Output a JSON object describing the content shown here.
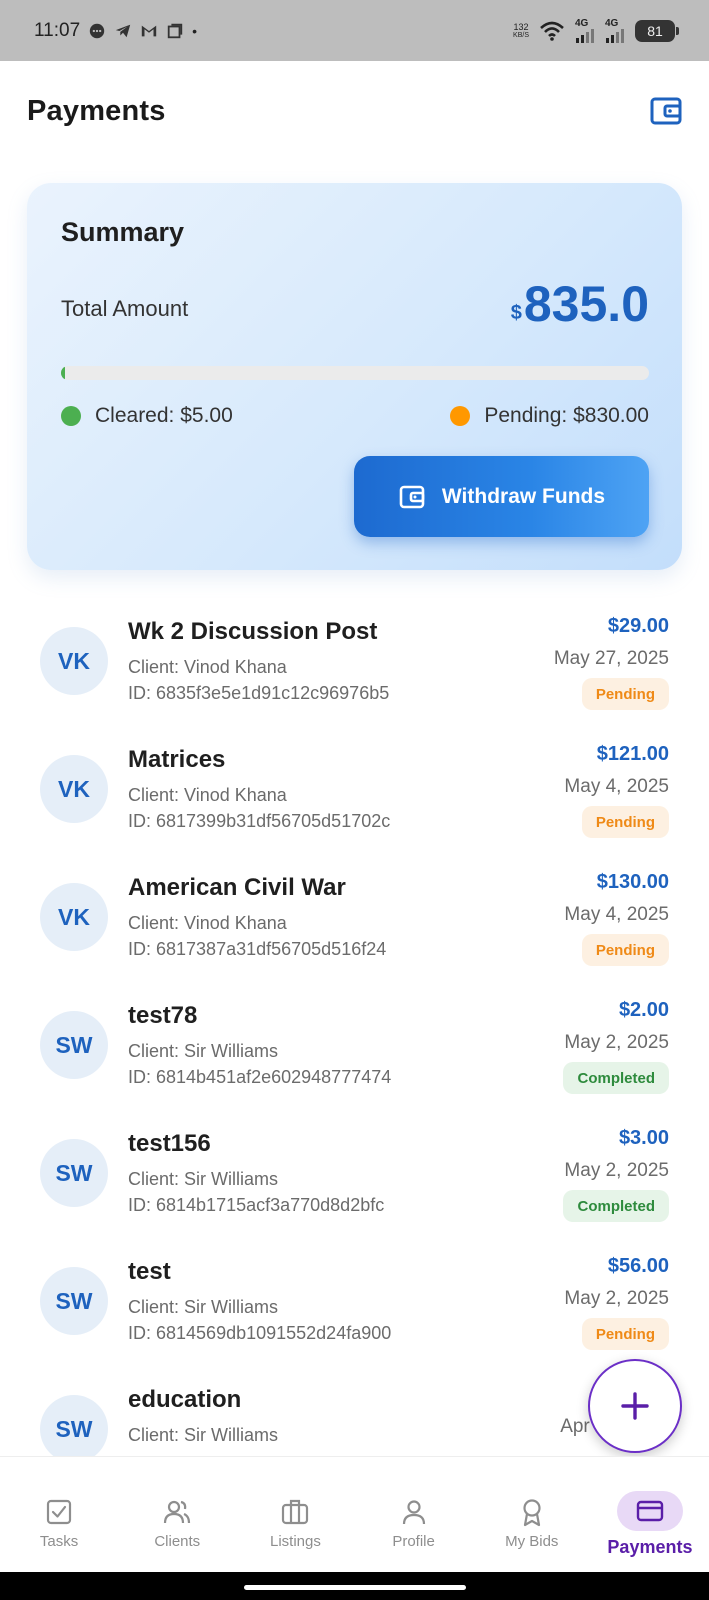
{
  "status_bar": {
    "time": "11:07",
    "network_speed_value": "132",
    "network_speed_unit": "KB/S",
    "signal_1": "4G",
    "signal_2": "4G",
    "battery": "81"
  },
  "header": {
    "title": "Payments"
  },
  "summary": {
    "title": "Summary",
    "total_label": "Total Amount",
    "currency_symbol": "$",
    "total_value": "835.0",
    "cleared_fraction": 0.006,
    "cleared_label": "Cleared: $5.00",
    "pending_label": "Pending: $830.00",
    "withdraw_label": "Withdraw Funds",
    "colors": {
      "cleared": "#4caf50",
      "pending": "#ff9800",
      "accent": "#1e62be"
    }
  },
  "payments": [
    {
      "initials": "VK",
      "title": "Wk 2 Discussion Post",
      "client": "Client: Vinod  Khana",
      "id": "ID: 6835f3e5e1d91c12c96976b5",
      "amount": "$29.00",
      "date": "May 27, 2025",
      "status": "Pending",
      "status_type": "pending"
    },
    {
      "initials": "VK",
      "title": "Matrices",
      "client": "Client: Vinod  Khana",
      "id": "ID: 6817399b31df56705d51702c",
      "amount": "$121.00",
      "date": "May 4, 2025",
      "status": "Pending",
      "status_type": "pending"
    },
    {
      "initials": "VK",
      "title": "American Civil War",
      "client": "Client: Vinod  Khana",
      "id": "ID: 6817387a31df56705d516f24",
      "amount": "$130.00",
      "date": "May 4, 2025",
      "status": "Pending",
      "status_type": "pending"
    },
    {
      "initials": "SW",
      "title": "test78",
      "client": "Client: Sir Williams",
      "id": "ID: 6814b451af2e602948777474",
      "amount": "$2.00",
      "date": "May 2, 2025",
      "status": "Completed",
      "status_type": "completed"
    },
    {
      "initials": "SW",
      "title": "test156",
      "client": "Client: Sir Williams",
      "id": "ID: 6814b1715acf3a770d8d2bfc",
      "amount": "$3.00",
      "date": "May 2, 2025",
      "status": "Completed",
      "status_type": "completed"
    },
    {
      "initials": "SW",
      "title": "test",
      "client": "Client: Sir Williams",
      "id": "ID: 6814569db1091552d24fa900",
      "amount": "$56.00",
      "date": "May 2, 2025",
      "status": "Pending",
      "status_type": "pending"
    },
    {
      "initials": "SW",
      "title": "education",
      "client": "Client: Sir Williams",
      "id": "",
      "amount": "",
      "date": "Apr 2?, 2025",
      "status": "",
      "status_type": ""
    }
  ],
  "bottom_nav": [
    {
      "label": "Tasks",
      "icon": "tasks-icon",
      "active": false
    },
    {
      "label": "Clients",
      "icon": "clients-icon",
      "active": false
    },
    {
      "label": "Listings",
      "icon": "listings-icon",
      "active": false
    },
    {
      "label": "Profile",
      "icon": "profile-icon",
      "active": false
    },
    {
      "label": "My Bids",
      "icon": "bids-icon",
      "active": false
    },
    {
      "label": "Payments",
      "icon": "payments-icon",
      "active": true
    }
  ]
}
